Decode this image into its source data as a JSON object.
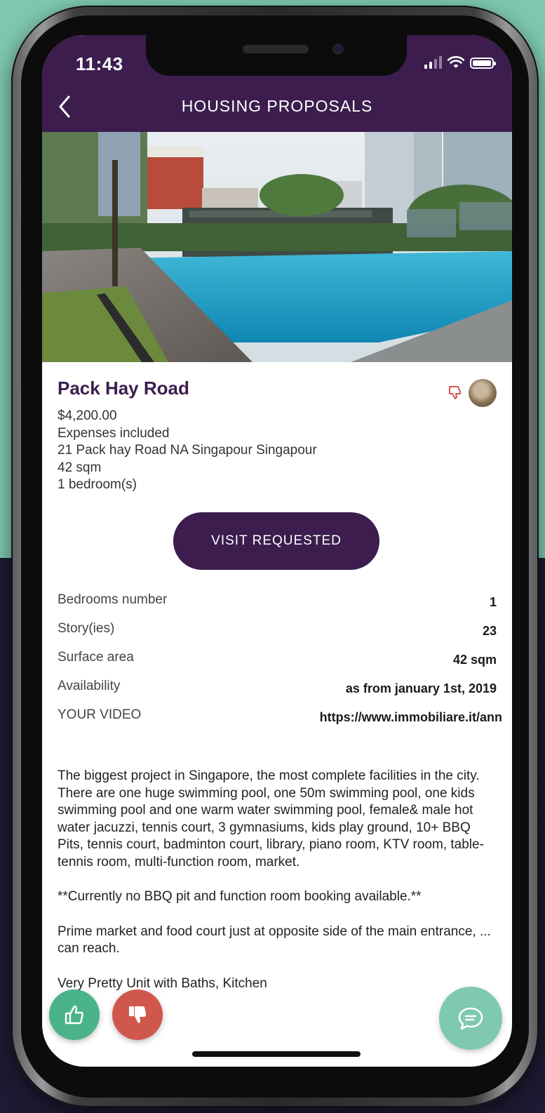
{
  "status_bar": {
    "time": "11:43"
  },
  "header": {
    "title": "HOUSING PROPOSALS"
  },
  "property": {
    "title": "Pack Hay Road",
    "price": "$4,200.00",
    "expenses": "Expenses included",
    "address": "21 Pack hay Road NA Singapour Singapour",
    "surface": "42 sqm",
    "bedrooms": "1 bedroom(s)"
  },
  "visit_button": {
    "label": "VISIT REQUESTED"
  },
  "specs": [
    {
      "label": "Bedrooms number",
      "value": "1"
    },
    {
      "label": "Story(ies)",
      "value": "23"
    },
    {
      "label": "Surface area",
      "value": "42 sqm"
    },
    {
      "label": "Availability",
      "value": "as from january 1st, 2019"
    },
    {
      "label": "YOUR VIDEO",
      "value": "https://www.immobiliare.it/ann"
    }
  ],
  "description": {
    "p1": "The biggest project in Singapore, the most complete facilities in the city. There are one huge swimming pool, one 50m swimming pool, one kids swimming pool and one warm water swimming pool, female& male hot water jacuzzi, tennis court, 3 gymnasiums, kids play ground, 10+ BBQ Pits, tennis court, badminton court, library, piano room, KTV room, table-tennis room, multi-function room, market.",
    "p2": "**Currently no BBQ pit and function room booking available.**",
    "p3": "Prime market and food court just at opposite side of the main entrance, ... can reach.",
    "p4": "Very Pretty Unit with Baths, Kitchen"
  },
  "icons": {
    "back": "chevron-left-icon",
    "like": "thumbs-up-icon",
    "dislike": "thumbs-down-icon",
    "chat": "chat-bubble-icon"
  },
  "colors": {
    "header": "#3c1d4e",
    "like": "#4bb38a",
    "dislike": "#d0574b",
    "chat": "#7fc8b1",
    "background_top": "#7ec8b0",
    "background_bottom": "#1c1b33"
  }
}
